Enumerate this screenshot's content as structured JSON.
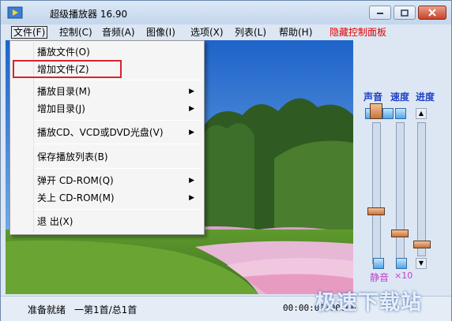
{
  "window": {
    "title": "超级播放器 16.90"
  },
  "menubar": {
    "items": [
      {
        "label": "文件(F)"
      },
      {
        "label": "控制(C)"
      },
      {
        "label": "音频(A)"
      },
      {
        "label": "图像(I)"
      },
      {
        "label": "选项(X)"
      },
      {
        "label": "列表(L)"
      },
      {
        "label": "帮助(H)"
      },
      {
        "label": "隐藏控制面板"
      }
    ]
  },
  "file_menu": {
    "items": [
      {
        "label": "播放文件(O)"
      },
      {
        "label": "增加文件(Z)"
      },
      {
        "label": "播放目录(M)"
      },
      {
        "label": "增加目录(J)"
      },
      {
        "label": "播放CD、VCD或DVD光盘(V)"
      },
      {
        "label": "保存播放列表(B)"
      },
      {
        "label": "弹开 CD-ROM(Q)"
      },
      {
        "label": "关上 CD-ROM(M)"
      },
      {
        "label": "退    出(X)"
      }
    ],
    "submenu_arrow": "▶"
  },
  "controls": {
    "volume_label": "声音",
    "speed_label": "速度",
    "progress_label": "进度",
    "mute_label": "静音",
    "speed_multiplier": "×10"
  },
  "status": {
    "state": "准备就绪",
    "track_info": "一第1首/总1首",
    "time": "00:00:00/00:00"
  },
  "watermark": "极速下载站",
  "colors": {
    "accent_red": "#e00000",
    "control_label_blue": "#1f3fc7",
    "mute_purple": "#c03fd0",
    "highlight_red": "#d9232d"
  }
}
